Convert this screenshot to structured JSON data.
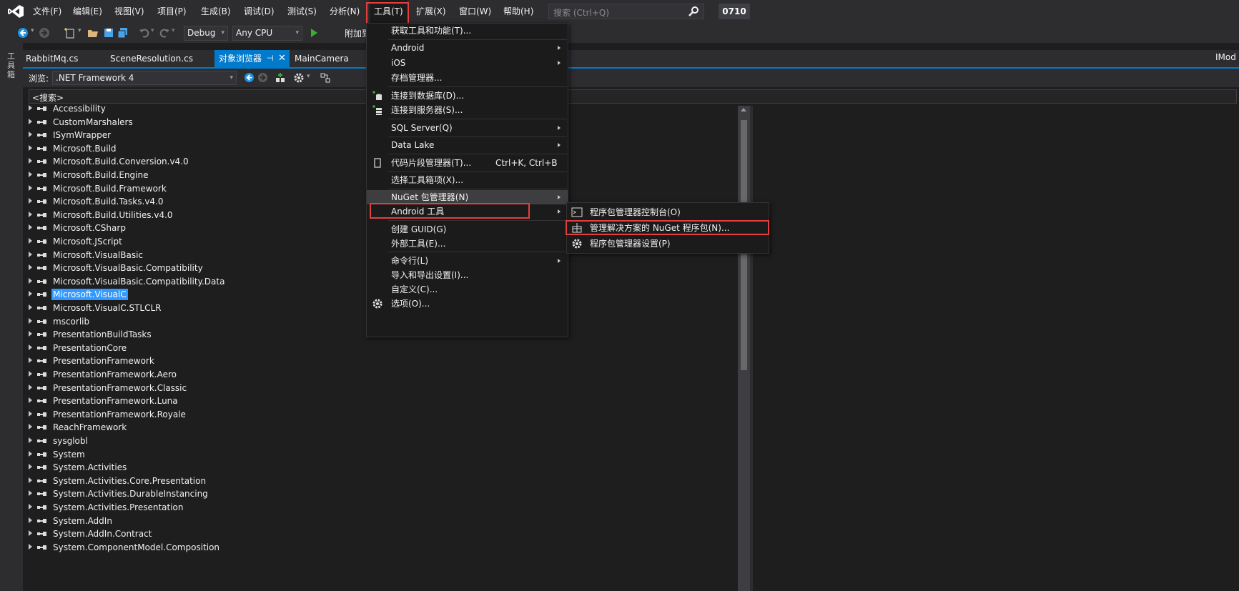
{
  "menubar": {
    "items": [
      {
        "label": "文件(F)"
      },
      {
        "label": "编辑(E)"
      },
      {
        "label": "视图(V)"
      },
      {
        "label": "项目(P)"
      },
      {
        "label": "生成(B)"
      },
      {
        "label": "调试(D)"
      },
      {
        "label": "测试(S)"
      },
      {
        "label": "分析(N)"
      },
      {
        "label": "工具(T)"
      },
      {
        "label": "扩展(X)"
      },
      {
        "label": "窗口(W)"
      },
      {
        "label": "帮助(H)"
      }
    ],
    "search_placeholder": "搜索 (Ctrl+Q)",
    "solution_name": "0710"
  },
  "toolbar": {
    "config": "Debug",
    "platform": "Any CPU",
    "attach_label": "附加到"
  },
  "side_strip": {
    "label": "工具箱"
  },
  "tabs": [
    {
      "label": "RabbitMq.cs"
    },
    {
      "label": "SceneResolution.cs"
    },
    {
      "label": "对象浏览器"
    },
    {
      "label": "MainCamera"
    }
  ],
  "right_tab_label": "IMod",
  "object_browser": {
    "browse_label": "浏览:",
    "browse_value": ".NET Framework 4",
    "search_text": "<搜索>",
    "assemblies": [
      "Accessibility",
      "CustomMarshalers",
      "ISymWrapper",
      "Microsoft.Build",
      "Microsoft.Build.Conversion.v4.0",
      "Microsoft.Build.Engine",
      "Microsoft.Build.Framework",
      "Microsoft.Build.Tasks.v4.0",
      "Microsoft.Build.Utilities.v4.0",
      "Microsoft.CSharp",
      "Microsoft.JScript",
      "Microsoft.VisualBasic",
      "Microsoft.VisualBasic.Compatibility",
      "Microsoft.VisualBasic.Compatibility.Data",
      "Microsoft.VisualC",
      "Microsoft.VisualC.STLCLR",
      "mscorlib",
      "PresentationBuildTasks",
      "PresentationCore",
      "PresentationFramework",
      "PresentationFramework.Aero",
      "PresentationFramework.Classic",
      "PresentationFramework.Luna",
      "PresentationFramework.Royale",
      "ReachFramework",
      "sysglobl",
      "System",
      "System.Activities",
      "System.Activities.Core.Presentation",
      "System.Activities.DurableInstancing",
      "System.Activities.Presentation",
      "System.AddIn",
      "System.AddIn.Contract",
      "System.ComponentModel.Composition"
    ],
    "selected": "Microsoft.VisualC"
  },
  "tools_menu": {
    "items": [
      {
        "label": "获取工具和功能(T)..."
      },
      {
        "label": "Android"
      },
      {
        "label": "iOS"
      },
      {
        "label": "存档管理器..."
      },
      {
        "label": "连接到数据库(D)..."
      },
      {
        "label": "连接到服务器(S)..."
      },
      {
        "label": "SQL Server(Q)"
      },
      {
        "label": "Data Lake"
      },
      {
        "label": "代码片段管理器(T)...",
        "shortcut": "Ctrl+K, Ctrl+B"
      },
      {
        "label": "选择工具箱项(X)..."
      },
      {
        "label": "NuGet 包管理器(N)"
      },
      {
        "label": "Android 工具"
      },
      {
        "label": "创建 GUID(G)"
      },
      {
        "label": "外部工具(E)..."
      },
      {
        "label": "命令行(L)"
      },
      {
        "label": "导入和导出设置(I)..."
      },
      {
        "label": "自定义(C)..."
      },
      {
        "label": "选项(O)..."
      }
    ]
  },
  "nuget_submenu": {
    "items": [
      {
        "label": "程序包管理器控制台(O)"
      },
      {
        "label": "管理解决方案的 NuGet 程序包(N)..."
      },
      {
        "label": "程序包管理器设置(P)"
      }
    ]
  },
  "colors": {
    "accent": "#007acc",
    "highlight_box": "#e33f3f",
    "selection": "#3399ff",
    "menu_bg": "#1b1b1c",
    "chrome_bg": "#2d2d30"
  }
}
